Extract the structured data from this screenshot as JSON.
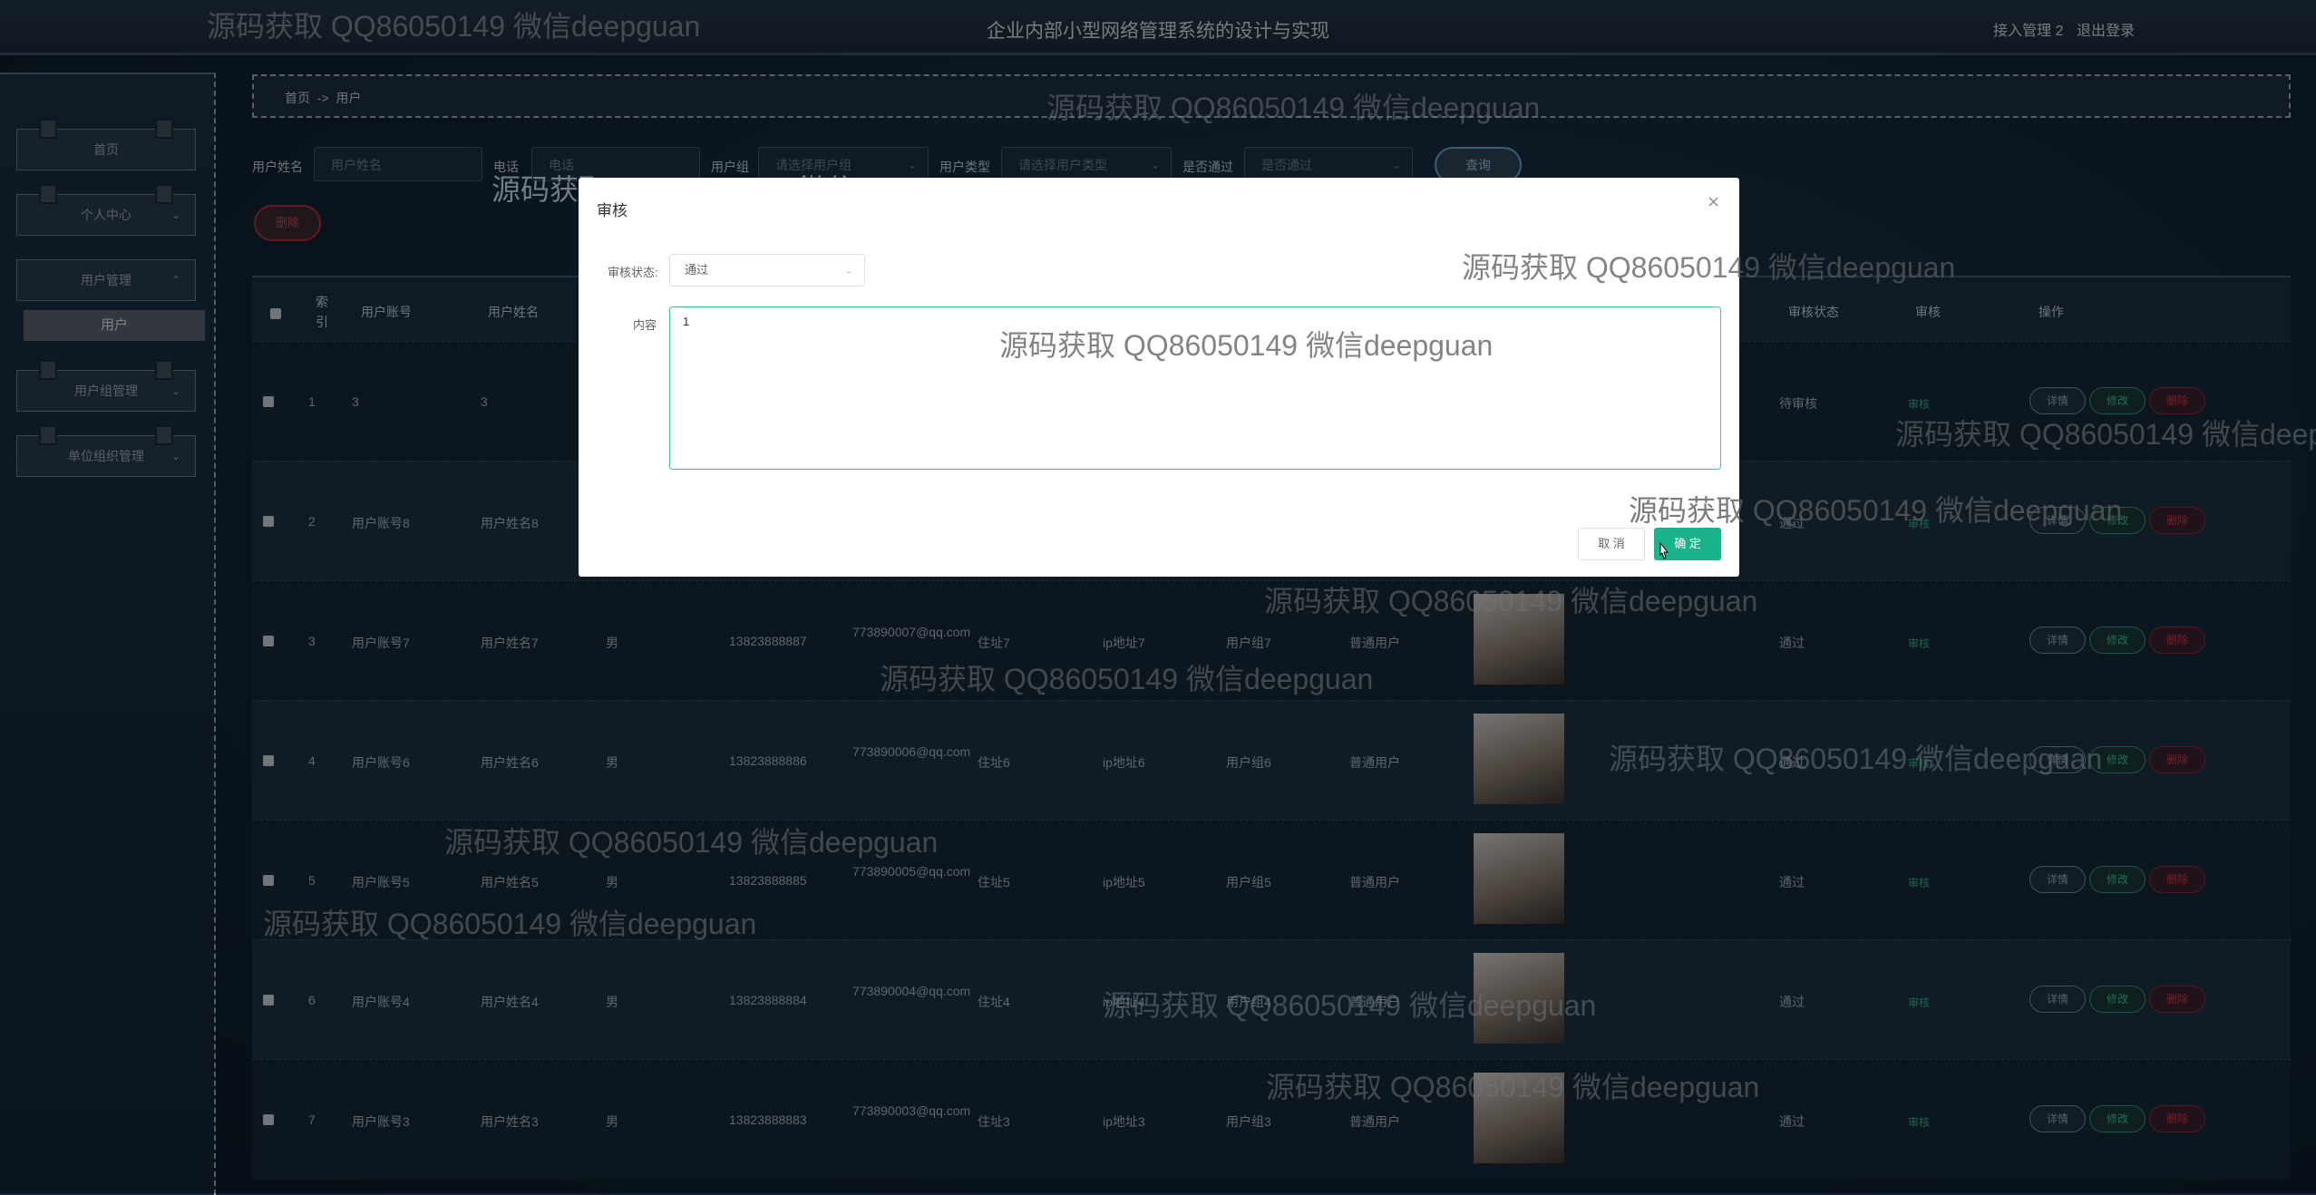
{
  "header": {
    "title": "企业内部小型网络管理系统的设计与实现",
    "user": "接入管理 2",
    "logout": "退出登录"
  },
  "watermark": "源码获取 QQ86050149 微信deepguan",
  "sidebar": {
    "items": [
      {
        "label": "首页"
      },
      {
        "label": "个人中心"
      },
      {
        "label": "用户管理"
      },
      {
        "label": "用户组管理"
      },
      {
        "label": "单位组织管理"
      }
    ],
    "active_sub": "用户"
  },
  "breadcrumb": {
    "home": "首页",
    "sep": "->",
    "current": "用户"
  },
  "search": {
    "name_label": "用户姓名",
    "name_placeholder": "用户姓名",
    "phone_label": "电话",
    "phone_placeholder": "电话",
    "group_label": "用户组",
    "group_placeholder": "请选择用户组",
    "type_label": "用户类型",
    "type_placeholder": "请选择用户类型",
    "pass_label": "是否通过",
    "pass_placeholder": "是否通过",
    "query_button": "查询",
    "delete_button": "删除"
  },
  "table": {
    "headers": {
      "index": "索引",
      "account": "用户账号",
      "name": "用户姓名",
      "status": "审核状态",
      "audit": "审核",
      "ops": "操作"
    },
    "rows": [
      {
        "index": "1",
        "account": "3",
        "name": "3",
        "gender": "",
        "phone": "",
        "email": "",
        "address": "",
        "ip": "",
        "group": "",
        "type": "",
        "status": "待审核",
        "audit": "审核"
      },
      {
        "index": "2",
        "account": "用户账号8",
        "name": "用户姓名8",
        "gender": "",
        "phone": "",
        "email": "",
        "address": "",
        "ip": "",
        "group": "",
        "type": "",
        "status": "通过",
        "audit": "审核"
      },
      {
        "index": "3",
        "account": "用户账号7",
        "name": "用户姓名7",
        "gender": "男",
        "phone": "13823888887",
        "email": "773890007@qq.com",
        "address": "住址7",
        "ip": "ip地址7",
        "group": "用户组7",
        "type": "普通用户",
        "status": "通过",
        "audit": "审核"
      },
      {
        "index": "4",
        "account": "用户账号6",
        "name": "用户姓名6",
        "gender": "男",
        "phone": "13823888886",
        "email": "773890006@qq.com",
        "address": "住址6",
        "ip": "ip地址6",
        "group": "用户组6",
        "type": "普通用户",
        "status": "通过",
        "audit": "审核"
      },
      {
        "index": "5",
        "account": "用户账号5",
        "name": "用户姓名5",
        "gender": "男",
        "phone": "13823888885",
        "email": "773890005@qq.com",
        "address": "住址5",
        "ip": "ip地址5",
        "group": "用户组5",
        "type": "普通用户",
        "status": "通过",
        "audit": "审核"
      },
      {
        "index": "6",
        "account": "用户账号4",
        "name": "用户姓名4",
        "gender": "男",
        "phone": "13823888884",
        "email": "773890004@qq.com",
        "address": "住址4",
        "ip": "ip地址4",
        "group": "用户组4",
        "type": "普通用户",
        "status": "通过",
        "audit": "审核"
      },
      {
        "index": "7",
        "account": "用户账号3",
        "name": "用户姓名3",
        "gender": "男",
        "phone": "13823888883",
        "email": "773890003@qq.com",
        "address": "住址3",
        "ip": "ip地址3",
        "group": "用户组3",
        "type": "普通用户",
        "status": "通过",
        "audit": "审核"
      }
    ],
    "ops": {
      "detail": "详情",
      "edit": "修改",
      "delete": "删除"
    }
  },
  "modal": {
    "title": "审核",
    "status_label": "审核状态:",
    "status_value": "通过",
    "content_label": "内容",
    "content_value": "1",
    "cancel": "取 消",
    "confirm": "确 定"
  },
  "colors": {
    "accent": "#19b38c",
    "danger": "#cf3c4a",
    "background": "#0f2233"
  }
}
